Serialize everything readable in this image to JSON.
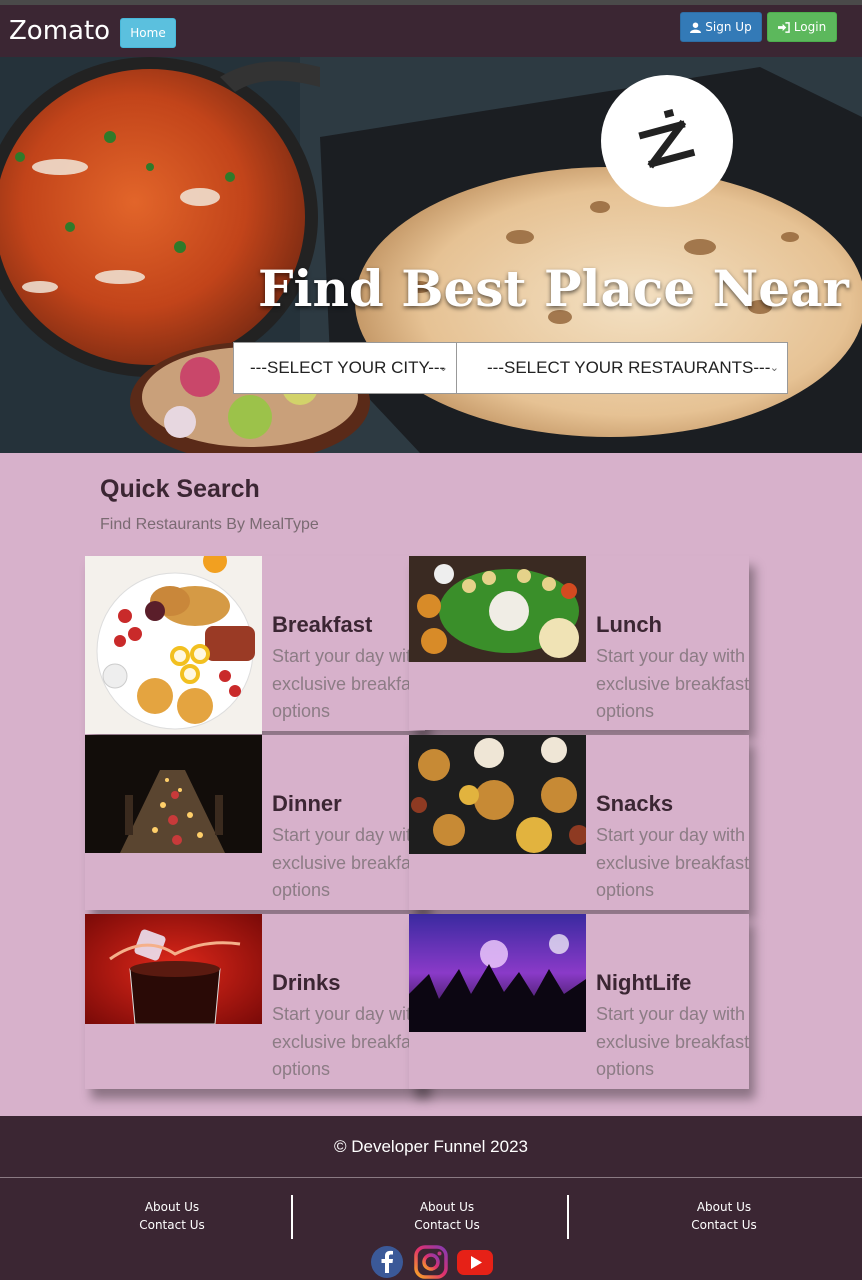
{
  "navbar": {
    "brand": "Zomato",
    "home_label": "Home",
    "signup_label": "Sign Up",
    "login_label": "Login",
    "signup_icon": "user-icon",
    "login_icon": "login-icon"
  },
  "hero": {
    "title": "Find Best Place Near",
    "city_select": "---SELECT YOUR CITY---",
    "restaurant_select": "---SELECT YOUR RESTAURANTS---",
    "logo_icon": "zomato-z-logo"
  },
  "quick_search": {
    "title": "Quick Search",
    "subtitle": "Find Restaurants By MealType",
    "cards": [
      {
        "name": "Breakfast",
        "desc": "Start your day with exclusive breakfast options",
        "image": "breakfast-image"
      },
      {
        "name": "Lunch",
        "desc": "Start your day with exclusive breakfast options",
        "image": "lunch-image"
      },
      {
        "name": "Dinner",
        "desc": "Start your day with exclusive breakfast options",
        "image": "dinner-image"
      },
      {
        "name": "Snacks",
        "desc": "Start your day with exclusive breakfast options",
        "image": "snacks-image"
      },
      {
        "name": "Drinks",
        "desc": "Start your day with exclusive breakfast options",
        "image": "drinks-image"
      },
      {
        "name": "NightLife",
        "desc": "Start your day with exclusive breakfast options",
        "image": "nightlife-image"
      }
    ]
  },
  "footer": {
    "copyright": "© Developer Funnel 2023",
    "columns": [
      {
        "about": "About Us",
        "contact": "Contact Us"
      },
      {
        "about": "About Us",
        "contact": "Contact Us"
      },
      {
        "about": "About Us",
        "contact": "Contact Us"
      }
    ],
    "social_icons": [
      "facebook-icon",
      "instagram-icon",
      "youtube-icon"
    ]
  },
  "colors": {
    "navbar_bg": "#3b2633",
    "section_bg": "#d7b1cb",
    "home_btn": "#5bc0de",
    "signup_btn": "#337ab7",
    "login_btn": "#5cb85c"
  }
}
